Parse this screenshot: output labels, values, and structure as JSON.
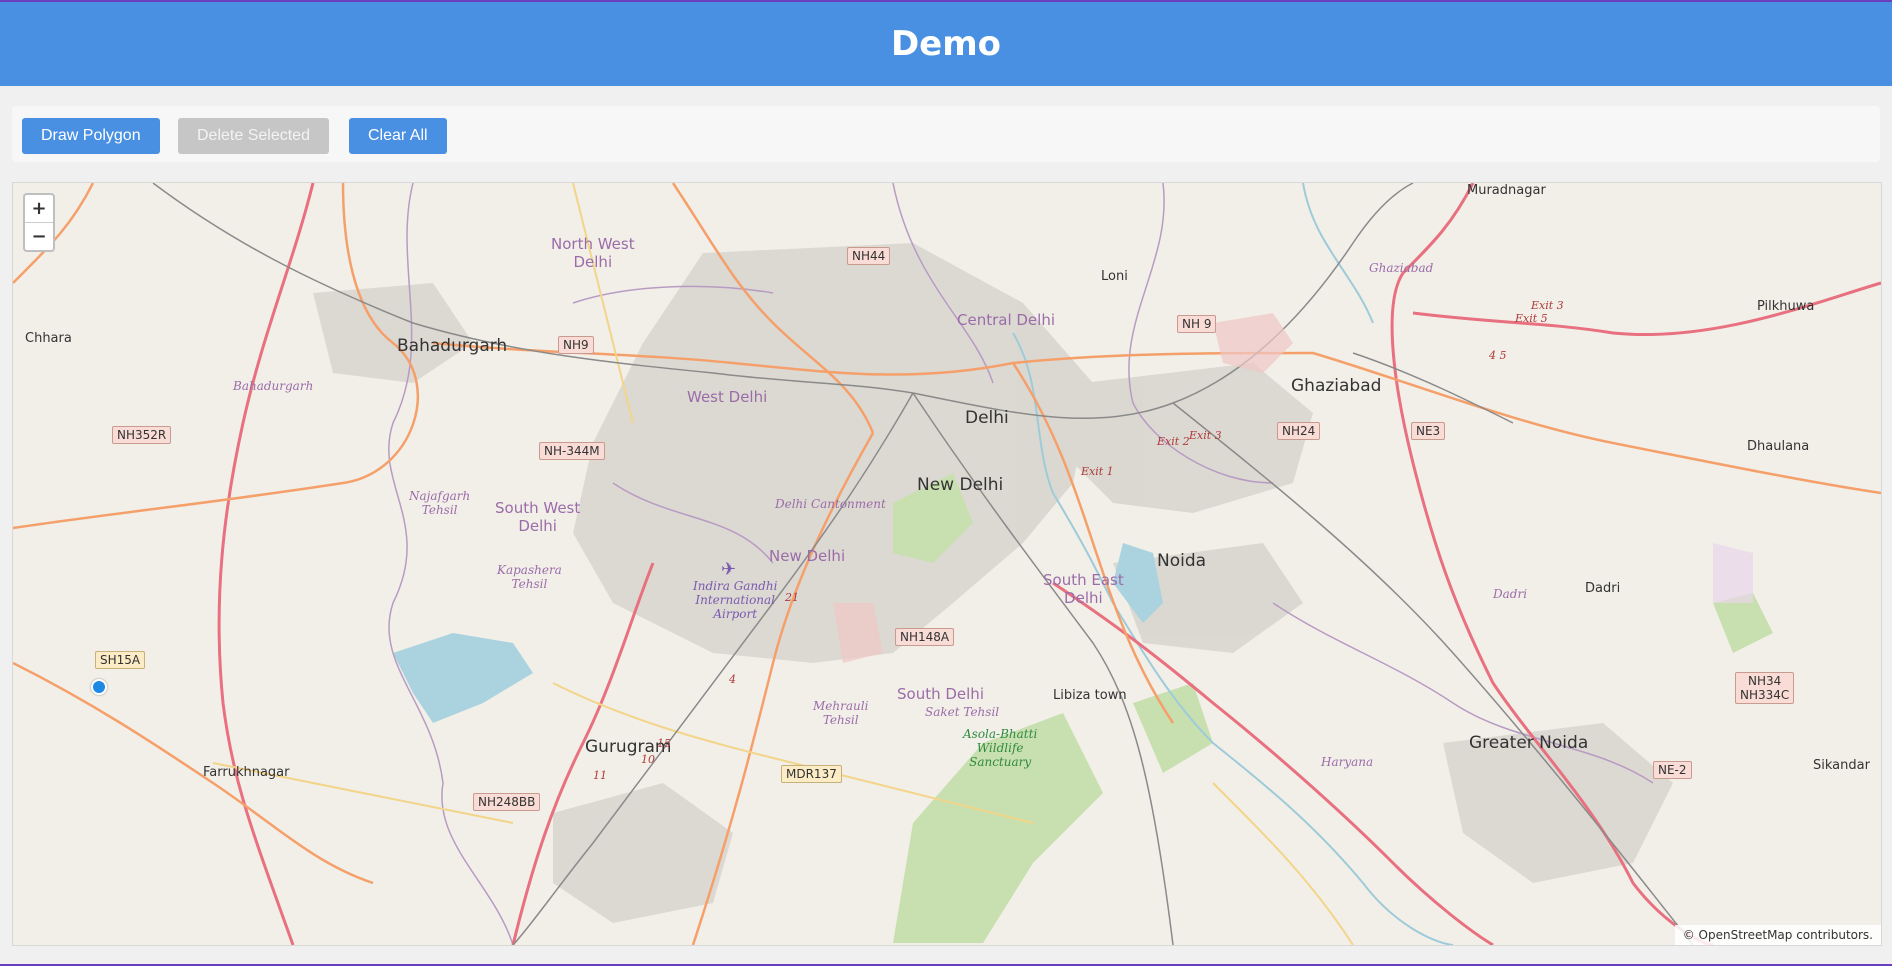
{
  "header": {
    "title": "Demo"
  },
  "toolbar": {
    "draw_polygon": "Draw Polygon",
    "delete_selected": "Delete Selected",
    "clear_all": "Clear All"
  },
  "map": {
    "zoom_in": "+",
    "zoom_out": "−",
    "attribution": "© OpenStreetMap contributors.",
    "places": {
      "muradnagar": "Muradnagar",
      "loni": "Loni",
      "pilkhuwa": "Pilkhuwa",
      "chhara": "Chhara",
      "bahadurgarh": "Bahadurgarh",
      "ghaziabad": "Ghaziabad",
      "delhi": "Delhi",
      "new_delhi": "New Delhi",
      "noida": "Noida",
      "dhaulana": "Dhaulana",
      "dadri": "Dadri",
      "gurugram": "Gurugram",
      "greater_noida": "Greater Noida",
      "farrukhnagar": "Farrukhnagar",
      "sikandar": "Sikandar",
      "libiza_town": "Libiza town"
    },
    "districts": {
      "north_west_1": "North West",
      "north_west_2": "Delhi",
      "central_delhi": "Central Delhi",
      "west_delhi": "West Delhi",
      "south_west_1": "South West",
      "south_west_2": "Delhi",
      "new_delhi_dist": "New Delhi",
      "south_east_1": "South East",
      "south_east_2": "Delhi",
      "south_delhi": "South Delhi",
      "ghaziabad_dist": "Ghaziabad",
      "dadri_dist": "Dadri",
      "haryana": "Haryana"
    },
    "tehsils": {
      "bahadurgarh_t": "Bahadurgarh",
      "najafgarh_1": "Najafgarh",
      "najafgarh_2": "Tehsil",
      "kapashera_1": "Kapashera",
      "kapashera_2": "Tehsil",
      "delhi_cantonment": "Delhi Cantonment",
      "mehrauli_1": "Mehrauli",
      "mehrauli_2": "Tehsil",
      "saket": "Saket Tehsil"
    },
    "airport": [
      "Indira Gandhi",
      "International",
      "Airport"
    ],
    "sanctuary": [
      "Asola-Bhatti",
      "Wildlife",
      "Sanctuary"
    ],
    "roads": {
      "nh44": "NH44",
      "nh9a": "NH 9",
      "nh9b": "NH9",
      "nh352r": "NH352R",
      "nh344m": "NH-344M",
      "nh24": "NH24",
      "ne3": "NE3",
      "nh148a": "NH148A",
      "sh15a": "SH15A",
      "nh34_1": "NH34",
      "nh34_2": "NH334C",
      "mdr137": "MDR137",
      "nh248bb": "NH248BB",
      "ne2": "NE-2"
    },
    "exits": {
      "exit3a": "Exit 3",
      "exit5": "Exit 5",
      "exit2": "Exit 2",
      "exit3b": "Exit 3",
      "exit1": "Exit 1",
      "e45": "4 5",
      "r21": "21",
      "r4": "4",
      "r15": "15",
      "r10": "10",
      "r11": "11"
    }
  }
}
